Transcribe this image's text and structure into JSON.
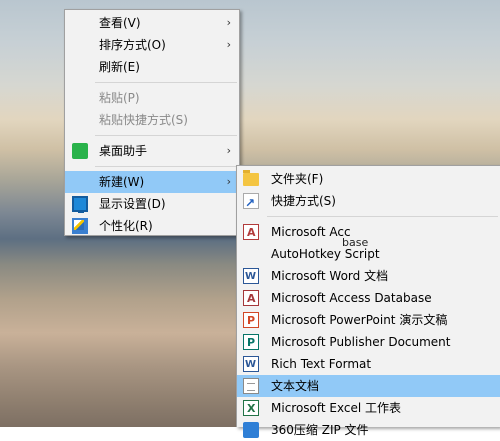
{
  "main_menu": {
    "items": [
      {
        "label": "查看(V)",
        "submenu": true,
        "disabled": false
      },
      {
        "label": "排序方式(O)",
        "submenu": true,
        "disabled": false
      },
      {
        "label": "刷新(E)",
        "submenu": false,
        "disabled": false
      },
      {
        "label": "粘贴(P)",
        "submenu": false,
        "disabled": true
      },
      {
        "label": "粘贴快捷方式(S)",
        "submenu": false,
        "disabled": true
      },
      {
        "label": "桌面助手",
        "submenu": true,
        "disabled": false,
        "icon": "desktop-assistant-icon"
      },
      {
        "label": "新建(W)",
        "submenu": true,
        "disabled": false,
        "highlighted": true
      },
      {
        "label": "显示设置(D)",
        "submenu": false,
        "disabled": false,
        "icon": "display-settings-icon"
      },
      {
        "label": "个性化(R)",
        "submenu": false,
        "disabled": false,
        "icon": "personalize-icon"
      }
    ],
    "arrow": "›"
  },
  "new_submenu": {
    "items": [
      {
        "label": "文件夹(F)",
        "icon": "folder-icon"
      },
      {
        "label": "快捷方式(S)",
        "icon": "shortcut-icon"
      },
      {
        "label": "Microsoft Acc",
        "icon": "access-icon"
      },
      {
        "label": "AutoHotkey Script",
        "icon": "autohotkey-icon"
      },
      {
        "label": "Microsoft Word 文档",
        "icon": "word-icon"
      },
      {
        "label": "Microsoft Access Database",
        "icon": "access-database-icon"
      },
      {
        "label": "Microsoft PowerPoint 演示文稿",
        "icon": "powerpoint-icon"
      },
      {
        "label": "Microsoft Publisher Document",
        "icon": "publisher-icon"
      },
      {
        "label": "Rich Text Format",
        "icon": "rich-text-icon"
      },
      {
        "label": "文本文档",
        "icon": "text-document-icon",
        "highlighted": true
      },
      {
        "label": "Microsoft Excel 工作表",
        "icon": "excel-icon"
      },
      {
        "label": "360压缩 ZIP 文件",
        "icon": "zip-icon"
      }
    ],
    "overlay_fragment": "base"
  }
}
